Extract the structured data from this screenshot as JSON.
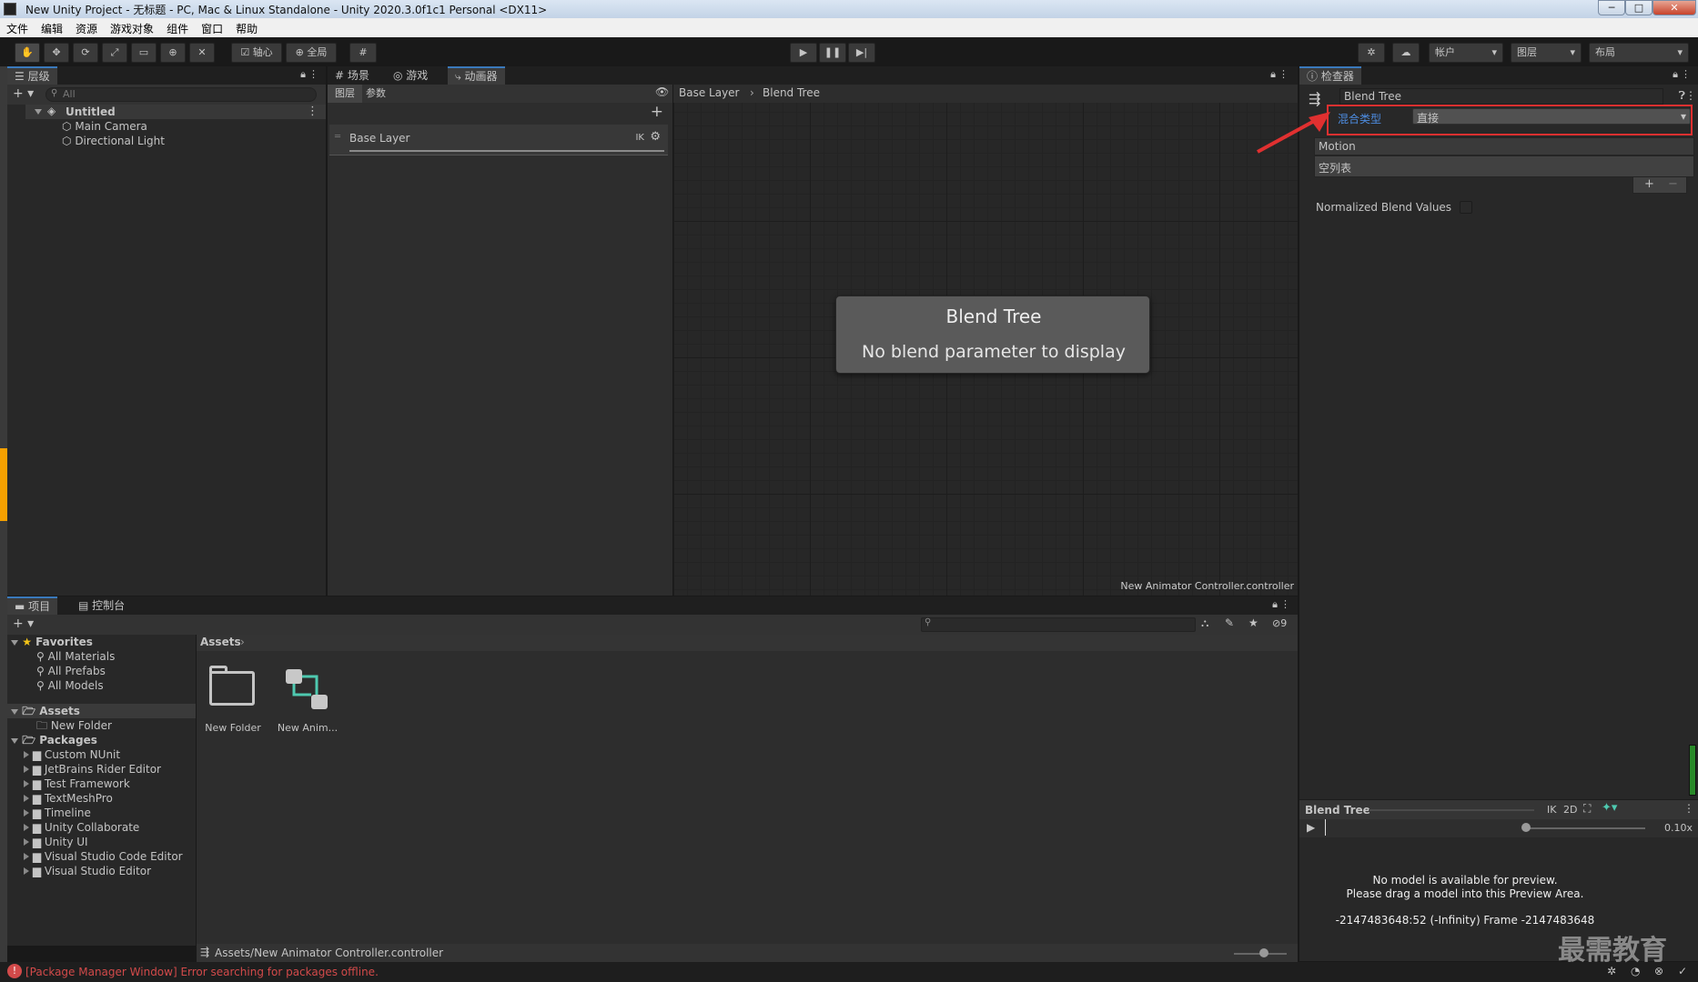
{
  "window": {
    "title": "New Unity Project - 无标题 - PC, Mac & Linux Standalone - Unity 2020.3.0f1c1 Personal <DX11>",
    "min": "─",
    "max": "□",
    "close": "✕"
  },
  "menu": [
    "文件",
    "编辑",
    "资源",
    "游戏对象",
    "组件",
    "窗口",
    "帮助"
  ],
  "toolbar": {
    "pivot": "轴心",
    "global": "全局",
    "account": "帐户",
    "layers": "图层",
    "layout": "布局"
  },
  "hierarchy": {
    "tab": "层级",
    "search_placeholder": "All",
    "scene": "Untitled",
    "items": [
      "Main Camera",
      "Directional Light"
    ]
  },
  "center_tabs": [
    "场景",
    "游戏",
    "动画器"
  ],
  "animator": {
    "left_tabs": [
      "图层",
      "参数"
    ],
    "layer_name": "Base Layer",
    "layer_ik": "IK",
    "breadcrumb": [
      "Base Layer",
      "Blend Tree"
    ],
    "node_title": "Blend Tree",
    "node_text": "No blend parameter to display",
    "footer": "New Animator Controller.controller"
  },
  "inspector": {
    "tab": "检查器",
    "name": "Blend Tree",
    "blend_type_label": "混合类型",
    "blend_type_value": "直接",
    "motion_header": "Motion",
    "empty_list": "空列表",
    "normalized_label": "Normalized Blend Values",
    "plus": "+",
    "minus": "−"
  },
  "preview": {
    "title": "Blend Tree",
    "ik": "IK",
    "mode2d": "2D",
    "speed": "0.10x",
    "msg1": "No model is available for preview.",
    "msg2": "Please drag a model into this Preview Area.",
    "frame": "-2147483648:52 (-Infinity) Frame -2147483648"
  },
  "project": {
    "tabs": [
      "项目",
      "控制台"
    ],
    "favorites": "Favorites",
    "fav_items": [
      "All Materials",
      "All Prefabs",
      "All Models"
    ],
    "assets": "Assets",
    "asset_children": [
      "New Folder"
    ],
    "packages": "Packages",
    "package_items": [
      "Custom NUnit",
      "JetBrains Rider Editor",
      "Test Framework",
      "TextMeshPro",
      "Timeline",
      "Unity Collaborate",
      "Unity UI",
      "Visual Studio Code Editor",
      "Visual Studio Editor"
    ],
    "breadcrumb": "Assets",
    "grid_items": [
      "New Folder",
      "New Anim..."
    ],
    "footer_path": "Assets/New Animator Controller.controller",
    "hidden_count": "9"
  },
  "status": {
    "error": "[Package Manager Window] Error searching for packages offline."
  },
  "watermark": "最需教育",
  "colors": {
    "accent": "#3a79bb",
    "highlight_box": "#e03030",
    "link_blue": "#4d8ce0",
    "error_red": "#d24a4a"
  }
}
